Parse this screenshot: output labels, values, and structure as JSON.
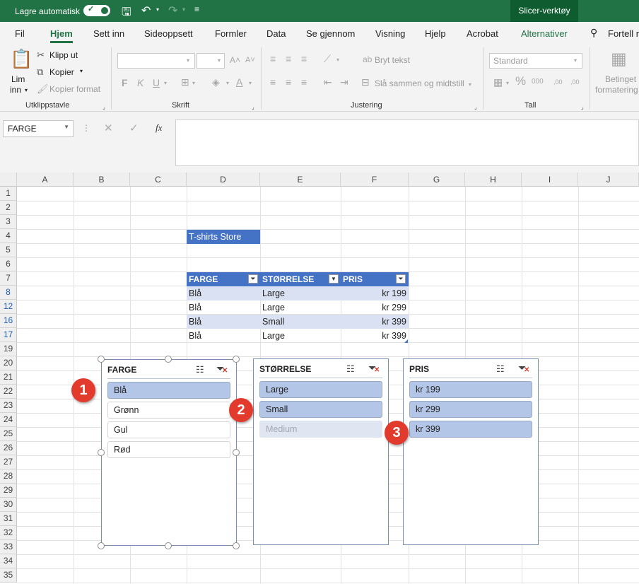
{
  "titlebar": {
    "autosave_label": "Lagre automatisk",
    "context_tab": "Slicer-verktøy"
  },
  "tabs": [
    "Fil",
    "Hjem",
    "Sett inn",
    "Sideoppsett",
    "Formler",
    "Data",
    "Se gjennom",
    "Visning",
    "Hjelp",
    "Acrobat",
    "Alternativer",
    "Fortell m"
  ],
  "ribbon": {
    "paste": "Lim",
    "paste2": "inn",
    "cut": "Klipp ut",
    "copy": "Kopier",
    "format_painter": "Kopier format",
    "clipboard_group": "Utklippstavle",
    "font_group": "Skrift",
    "wrap_text": "Bryt tekst",
    "merge_center": "Slå sammen og midtstill",
    "alignment_group": "Justering",
    "number_format": "Standard",
    "number_group": "Tall",
    "cond_format1": "Betinget",
    "cond_format2": "formatering",
    "bold": "F",
    "italic": "K",
    "underline": "U"
  },
  "formula_bar": {
    "name_box": "FARGE",
    "fx": "fx"
  },
  "columns": [
    "A",
    "B",
    "C",
    "D",
    "E",
    "F",
    "G",
    "H",
    "I",
    "J"
  ],
  "rows": [
    "1",
    "2",
    "3",
    "4",
    "5",
    "6",
    "7",
    "8",
    "12",
    "16",
    "17",
    "19",
    "20",
    "21",
    "22",
    "23",
    "24",
    "25",
    "26",
    "27",
    "28",
    "29",
    "30",
    "31",
    "32",
    "33",
    "34",
    "35"
  ],
  "filtered_rows": [
    "8",
    "12",
    "16",
    "17"
  ],
  "sheet": {
    "store_title": "T-shirts Store",
    "headers": [
      "FARGE",
      "STØRRELSE",
      "PRIS"
    ],
    "table": [
      [
        "Blå",
        "Large",
        "kr 199"
      ],
      [
        "Blå",
        "Large",
        "kr 299"
      ],
      [
        "Blå",
        "Small",
        "kr 399"
      ],
      [
        "Blå",
        "Large",
        "kr 399"
      ]
    ]
  },
  "slicers": {
    "farge": {
      "title": "FARGE",
      "items": [
        "Blå",
        "Grønn",
        "Gul",
        "Rød"
      ],
      "selected": [
        "Blå"
      ]
    },
    "storrelse": {
      "title": "STØRRELSE",
      "items": [
        "Large",
        "Small",
        "Medium"
      ],
      "selected": [
        "Large",
        "Small"
      ],
      "no_data": [
        "Medium"
      ]
    },
    "pris": {
      "title": "PRIS",
      "items": [
        "kr 199",
        "kr 299",
        "kr 399"
      ],
      "selected": [
        "kr 199",
        "kr 299",
        "kr 399"
      ]
    }
  },
  "badges": [
    "1",
    "2",
    "3"
  ],
  "colors": {
    "excel_green": "#217346",
    "table_header": "#4472c4",
    "band": "#d9e1f2",
    "slicer_selected": "#b4c6e7",
    "badge": "#e33a2e"
  }
}
